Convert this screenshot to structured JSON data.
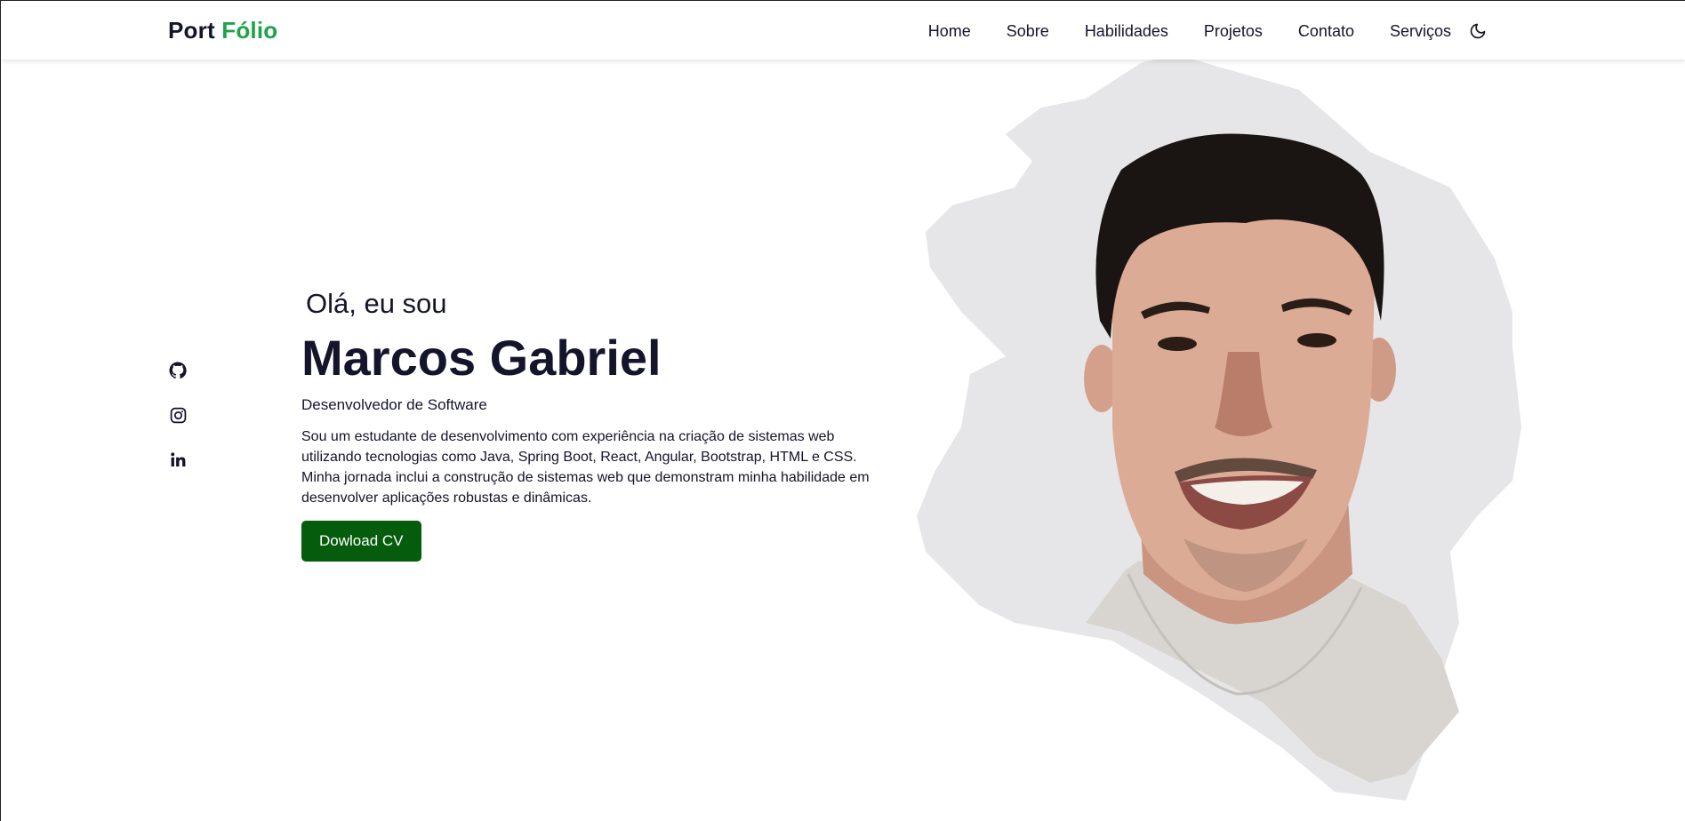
{
  "header": {
    "logo_part1": "Port",
    "logo_part2": "Fólio",
    "nav": [
      "Home",
      "Sobre",
      "Habilidades",
      "Projetos",
      "Contato",
      "Serviços"
    ],
    "theme_icon": "moon-icon"
  },
  "social": {
    "items": [
      {
        "icon": "github-icon"
      },
      {
        "icon": "instagram-icon"
      },
      {
        "icon": "linkedin-icon"
      }
    ]
  },
  "hero": {
    "greeting": "Olá, eu sou",
    "name": "Marcos Gabriel",
    "role": "Desenvolvedor de Software",
    "description": "Sou um estudante de desenvolvimento com experiência na criação de sistemas web utilizando tecnologias como Java, Spring Boot, React, Angular, Bootstrap, HTML e CSS. Minha jornada inclui a construção de sistemas web que demonstram minha habilidade em desenvolver aplicações robustas e dinâmicas.",
    "cv_button": "Dowload CV",
    "portrait": "profile-photo"
  },
  "colors": {
    "accent_green": "#1ea34a",
    "button_green": "#045c0c",
    "text_dark": "#14142b",
    "brush_gray": "#e6e6e8"
  }
}
